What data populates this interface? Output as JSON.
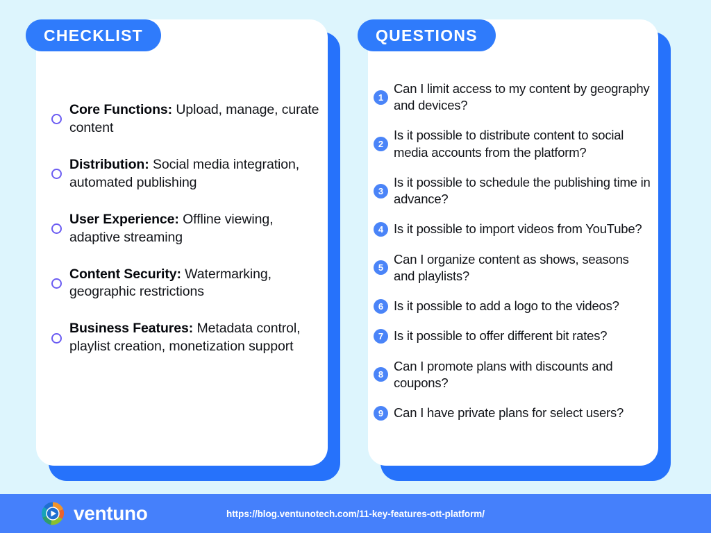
{
  "background_color": "#ddf5fd",
  "accent_color": "#2f7bfb",
  "checklist": {
    "header_label": "CHECKLIST",
    "items": [
      {
        "term": "Core Functions:",
        "detail": " Upload, manage, curate content"
      },
      {
        "term": "Distribution:",
        "detail": " Social media integration, automated publishing"
      },
      {
        "term": "User Experience:",
        "detail": " Offline viewing, adaptive streaming"
      },
      {
        "term": "Content Security:",
        "detail": " Watermarking, geographic restrictions"
      },
      {
        "term": "Business Features:",
        "detail": " Metadata control, playlist creation, monetization support"
      }
    ]
  },
  "questions": {
    "header_label": "QUESTIONS",
    "items": [
      {
        "number": "1",
        "text": "Can I limit access to my content by geography and devices?"
      },
      {
        "number": "2",
        "text": "Is it possible to distribute content to social media accounts from the platform?"
      },
      {
        "number": "3",
        "text": "Is it possible to schedule the publishing time in advance?"
      },
      {
        "number": "4",
        "text": "Is it possible to import videos from YouTube?"
      },
      {
        "number": "5",
        "text": "Can I organize content as shows, seasons and playlists?"
      },
      {
        "number": "6",
        "text": "Is it possible to add a logo to the videos?"
      },
      {
        "number": "7",
        "text": "Is it possible to offer different bit rates?"
      },
      {
        "number": "8",
        "text": "Can I promote plans with discounts and coupons?"
      },
      {
        "number": "9",
        "text": "Can I have private plans for select users?"
      }
    ]
  },
  "footer": {
    "logo_icon": "ventuno-play-circle-icon",
    "brand_name": "ventuno",
    "url": "https://blog.ventunotech.com/11-key-features-ott-platform/",
    "bar_color": "#4580fb"
  }
}
